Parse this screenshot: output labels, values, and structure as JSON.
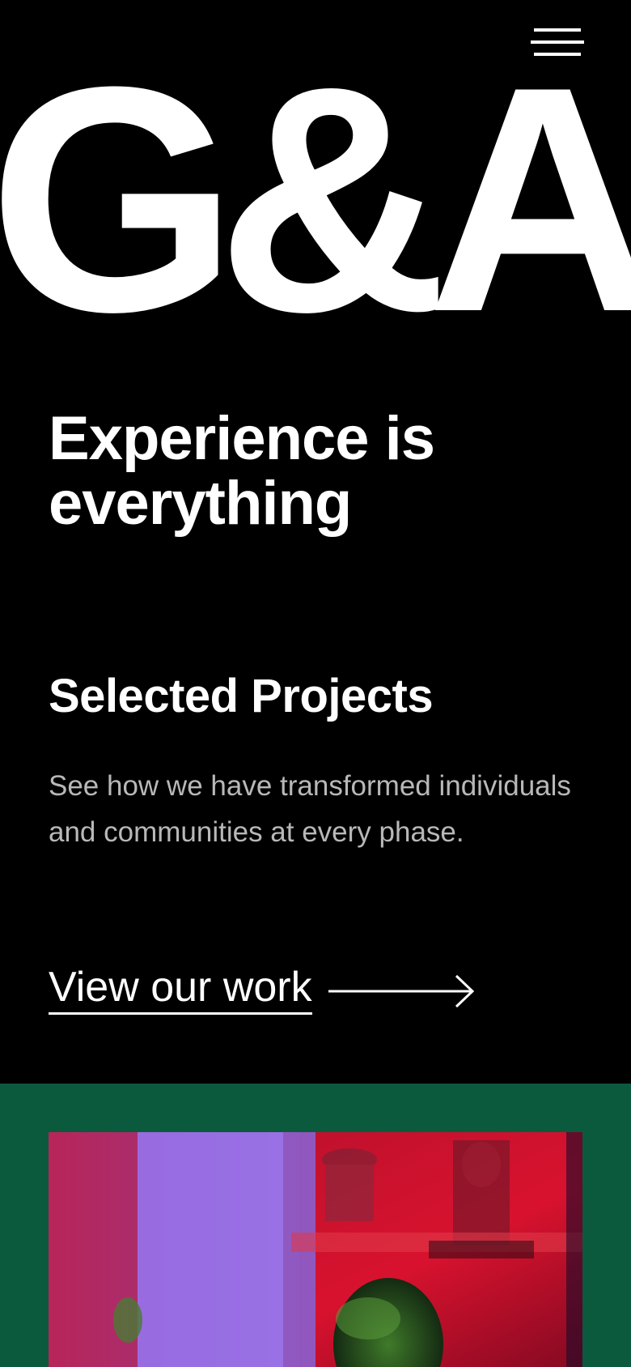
{
  "header": {
    "menu_icon": "hamburger-menu-icon",
    "logo_text": "G&A"
  },
  "hero": {
    "headline": "Experience is everything"
  },
  "selected_projects": {
    "heading": "Selected Projects",
    "description": "See how we have transformed individuals and communities at every phase.",
    "cta_label": "View our work",
    "cta_icon": "long-arrow-right-icon"
  },
  "featured_project": {
    "image_icon": "project-photo"
  },
  "colors": {
    "background": "#000000",
    "text": "#ffffff",
    "muted_text": "#b8b8b8",
    "accent_green": "#0b5a3e"
  }
}
